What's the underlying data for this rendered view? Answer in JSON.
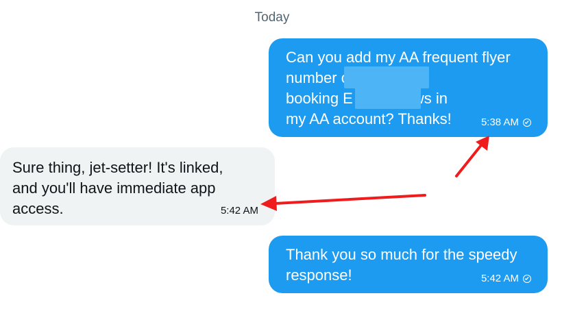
{
  "date_separator": "Today",
  "messages": [
    {
      "direction": "sent",
      "text": "Can you add my AA frequent flyer\nnumber            o my flight\nbooking E          so it shows in\nmy AA account? Thanks!",
      "time": "5:38 AM",
      "status_icon": "check-circle-icon"
    },
    {
      "direction": "received",
      "text": "Sure thing, jet-setter! It's linked,\nand you'll have immediate app\naccess.",
      "time": "5:42 AM"
    },
    {
      "direction": "sent",
      "text": "Thank you so much for the speedy\nresponse!",
      "time": "5:42 AM",
      "status_icon": "check-circle-icon"
    }
  ],
  "colors": {
    "sent_bubble": "#1d9bf0",
    "received_bubble": "#eff3f4",
    "redaction": "#4db5f6",
    "annotation_arrow": "#ee1c1c"
  }
}
